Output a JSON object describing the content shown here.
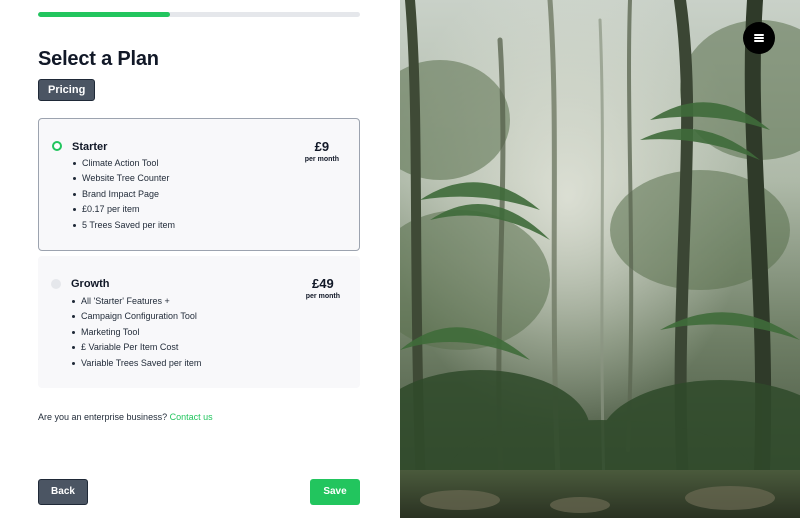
{
  "progress": {
    "fraction": 0.41
  },
  "header": {
    "title": "Select a Plan",
    "tag": "Pricing"
  },
  "plans": [
    {
      "name": "Starter",
      "selected": true,
      "price": "£9",
      "period": "per month",
      "features": [
        "Climate Action Tool",
        "Website Tree Counter",
        "Brand Impact Page",
        "£0.17 per item",
        "5 Trees Saved per item"
      ]
    },
    {
      "name": "Growth",
      "selected": false,
      "price": "£49",
      "period": "per month",
      "features": [
        "All 'Starter' Features +",
        "Campaign Configuration Tool",
        "Marketing Tool",
        "£ Variable Per Item Cost",
        "Variable Trees Saved per item"
      ]
    }
  ],
  "enterprise": {
    "question": "Are you an enterprise business?",
    "link": "Contact us"
  },
  "footer": {
    "back_label": "Back",
    "save_label": "Save"
  },
  "colors": {
    "accent": "#22c55e",
    "dark_button": "#4b5563",
    "card_bg": "#f8f8fa"
  },
  "icons": {
    "menu": "hamburger-menu-icon"
  },
  "hero_image": {
    "subject": "rainforest photograph"
  }
}
